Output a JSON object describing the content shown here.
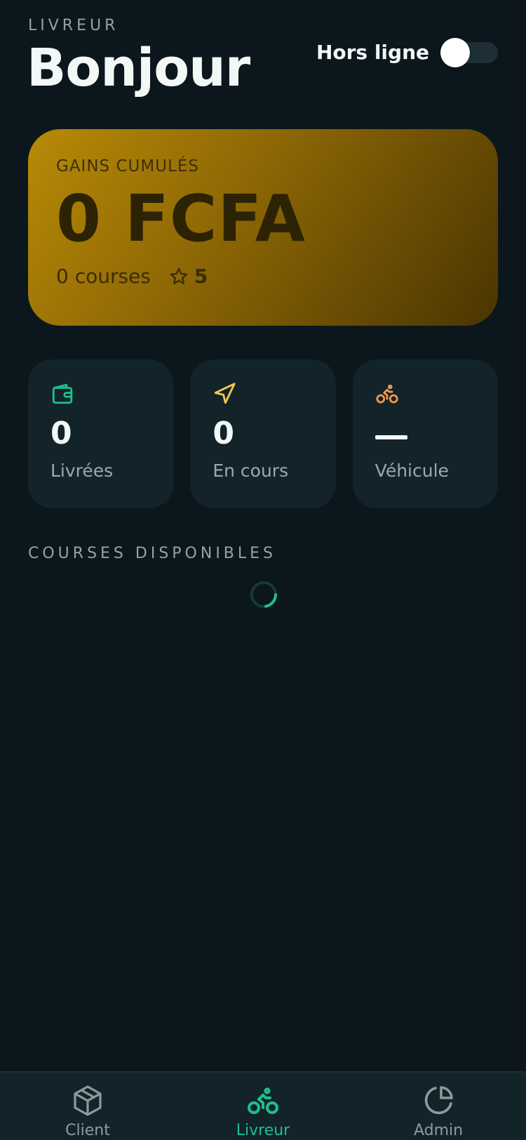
{
  "header": {
    "role_label": "LIVREUR",
    "title": "Bonjour",
    "status_label": "Hors ligne",
    "online": false
  },
  "earnings": {
    "label": "GAINS CUMULÉS",
    "amount": "0 FCFA",
    "courses": "0 courses",
    "rating": "5"
  },
  "stats": [
    {
      "icon": "wallet-icon",
      "value": "0",
      "label": "Livrées",
      "color": "#1fbf8f"
    },
    {
      "icon": "navigation-arrow-icon",
      "value": "0",
      "label": "En cours",
      "color": "#f2c94c"
    },
    {
      "icon": "bicycle-icon",
      "value": "—",
      "label": "Véhicule",
      "color": "#f2994a"
    }
  ],
  "section": {
    "title": "COURSES DISPONIBLES",
    "loading": true
  },
  "bottom_nav": [
    {
      "icon": "package-icon",
      "label": "Client",
      "active": false
    },
    {
      "icon": "bicycle-icon",
      "label": "Livreur",
      "active": true
    },
    {
      "icon": "pie-chart-icon",
      "label": "Admin",
      "active": false
    }
  ],
  "colors": {
    "background": "#0b171c",
    "card": "#13232a",
    "accent": "#1fbf8f",
    "gold": "#b88a06"
  }
}
